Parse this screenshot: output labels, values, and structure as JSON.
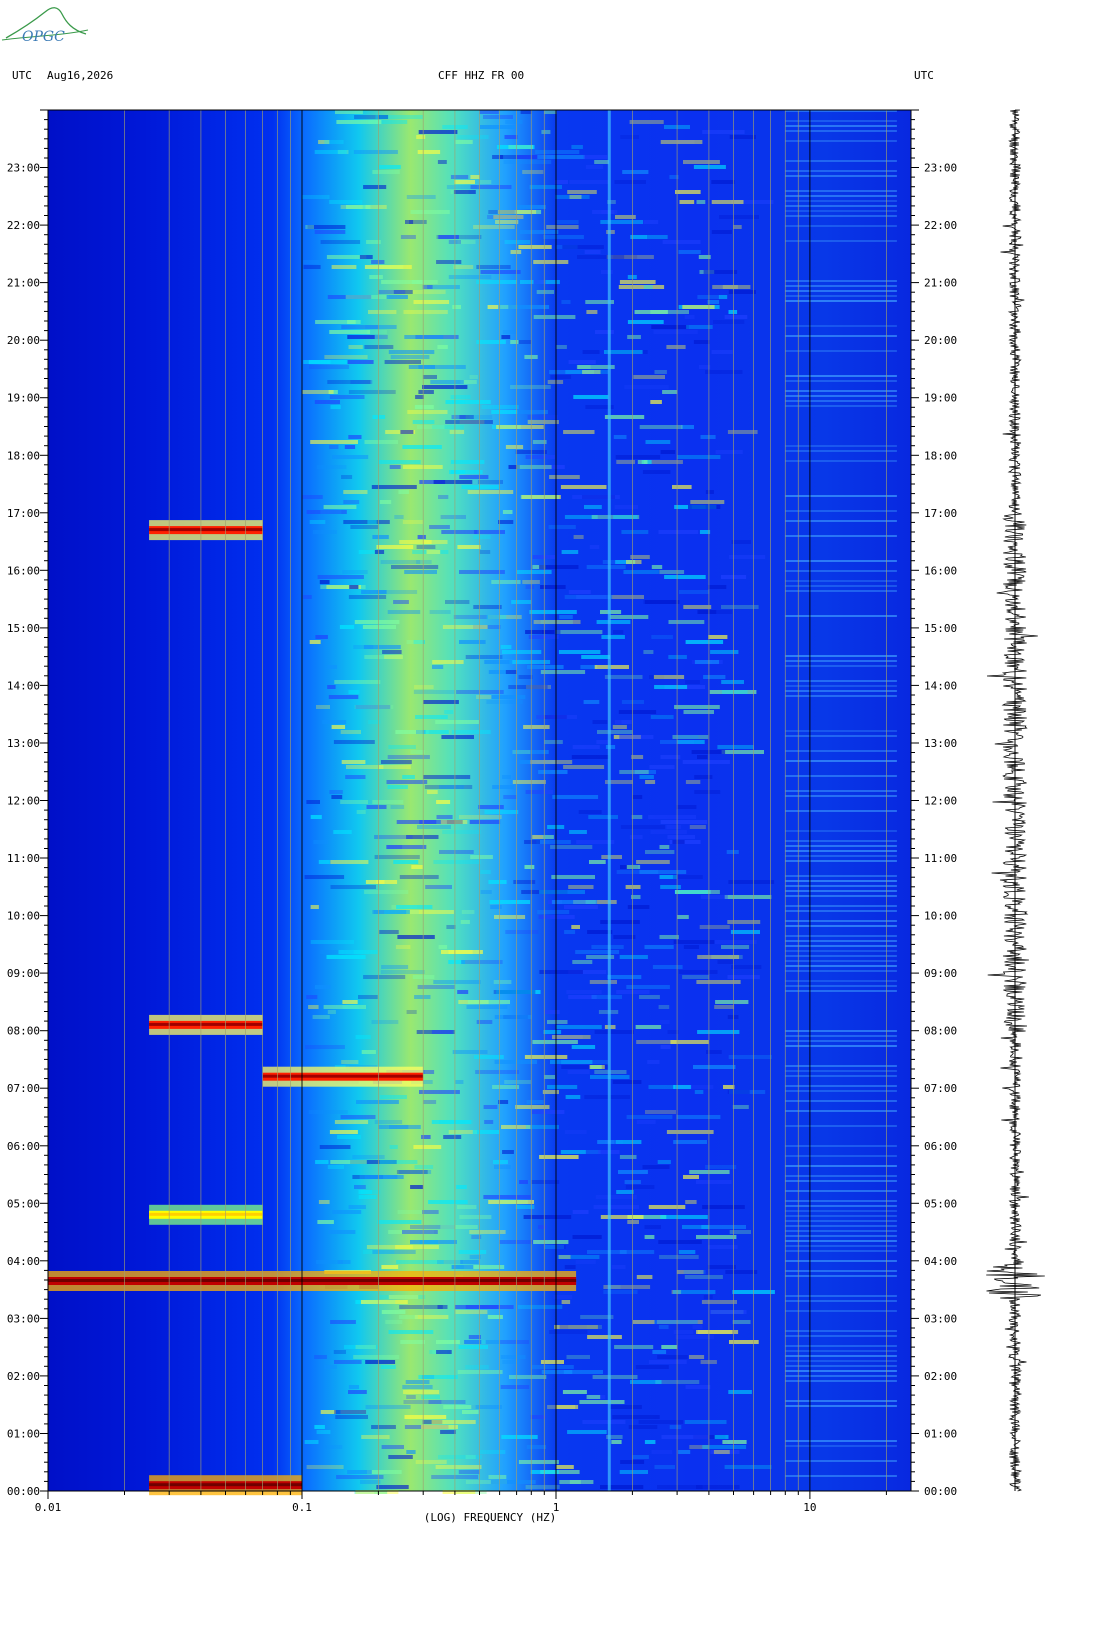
{
  "header": {
    "left_tz": "UTC",
    "date": "Aug16,2026",
    "station": "CFF HHZ FR 00",
    "right_tz": "UTC"
  },
  "logo": {
    "text": "OPGC"
  },
  "chart_data": {
    "type": "heatmap",
    "title": "CFF HHZ FR 00",
    "xlabel": "(LOG) FREQUENCY (HZ)",
    "x_scale": "log",
    "xlim": [
      0.01,
      25
    ],
    "x_ticks": [
      {
        "value": 0.01,
        "label": "0.01"
      },
      {
        "value": 0.1,
        "label": "0.1"
      },
      {
        "value": 1,
        "label": "1"
      },
      {
        "value": 10,
        "label": "10"
      }
    ],
    "y_ticks_left": [
      "00:00",
      "01:00",
      "02:00",
      "03:00",
      "04:00",
      "05:00",
      "06:00",
      "07:00",
      "08:00",
      "09:00",
      "10:00",
      "11:00",
      "12:00",
      "13:00",
      "14:00",
      "15:00",
      "16:00",
      "17:00",
      "18:00",
      "19:00",
      "20:00",
      "21:00",
      "22:00",
      "23:00"
    ],
    "y_ticks_right": [
      "00:00",
      "01:00",
      "02:00",
      "03:00",
      "04:00",
      "05:00",
      "06:00",
      "07:00",
      "08:00",
      "09:00",
      "10:00",
      "11:00",
      "12:00",
      "13:00",
      "14:00",
      "15:00",
      "16:00",
      "17:00",
      "18:00",
      "19:00",
      "20:00",
      "21:00",
      "22:00",
      "23:00"
    ],
    "ylim_hours": [
      0,
      24
    ],
    "colormap": [
      "#00008f",
      "#0000ff",
      "#0080ff",
      "#00ffff",
      "#80ff80",
      "#ffff00",
      "#ff8000",
      "#ff0000",
      "#800000"
    ],
    "grid": true,
    "events": [
      {
        "hour": 3.65,
        "fmin": 0.01,
        "fmax": 1.2,
        "level": "max"
      },
      {
        "hour": 7.2,
        "fmin": 0.07,
        "fmax": 0.3,
        "level": "high"
      },
      {
        "hour": 8.1,
        "fmin": 0.025,
        "fmax": 0.07,
        "level": "high"
      },
      {
        "hour": 16.7,
        "fmin": 0.025,
        "fmax": 0.07,
        "level": "high"
      },
      {
        "hour": 0.1,
        "fmin": 0.025,
        "fmax": 0.1,
        "level": "max"
      },
      {
        "hour": 4.8,
        "fmin": 0.025,
        "fmax": 0.07,
        "level": "medium"
      }
    ]
  }
}
